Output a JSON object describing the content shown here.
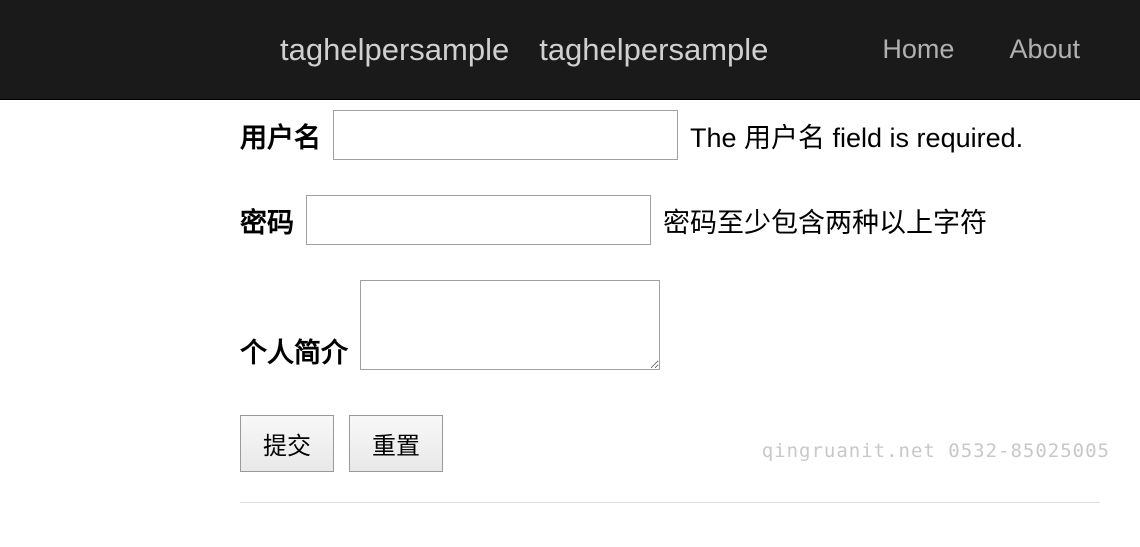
{
  "navbar": {
    "brand1": "taghelpersample",
    "brand2": "taghelpersample",
    "links": {
      "home": "Home",
      "about": "About"
    }
  },
  "form": {
    "username": {
      "label": "用户名",
      "value": "",
      "validation": "The 用户名 field is required."
    },
    "password": {
      "label": "密码",
      "value": "",
      "validation": "密码至少包含两种以上字符"
    },
    "bio": {
      "label": "个人简介",
      "value": ""
    },
    "buttons": {
      "submit": "提交",
      "reset": "重置"
    }
  },
  "watermark": "qingruanit.net 0532-85025005"
}
